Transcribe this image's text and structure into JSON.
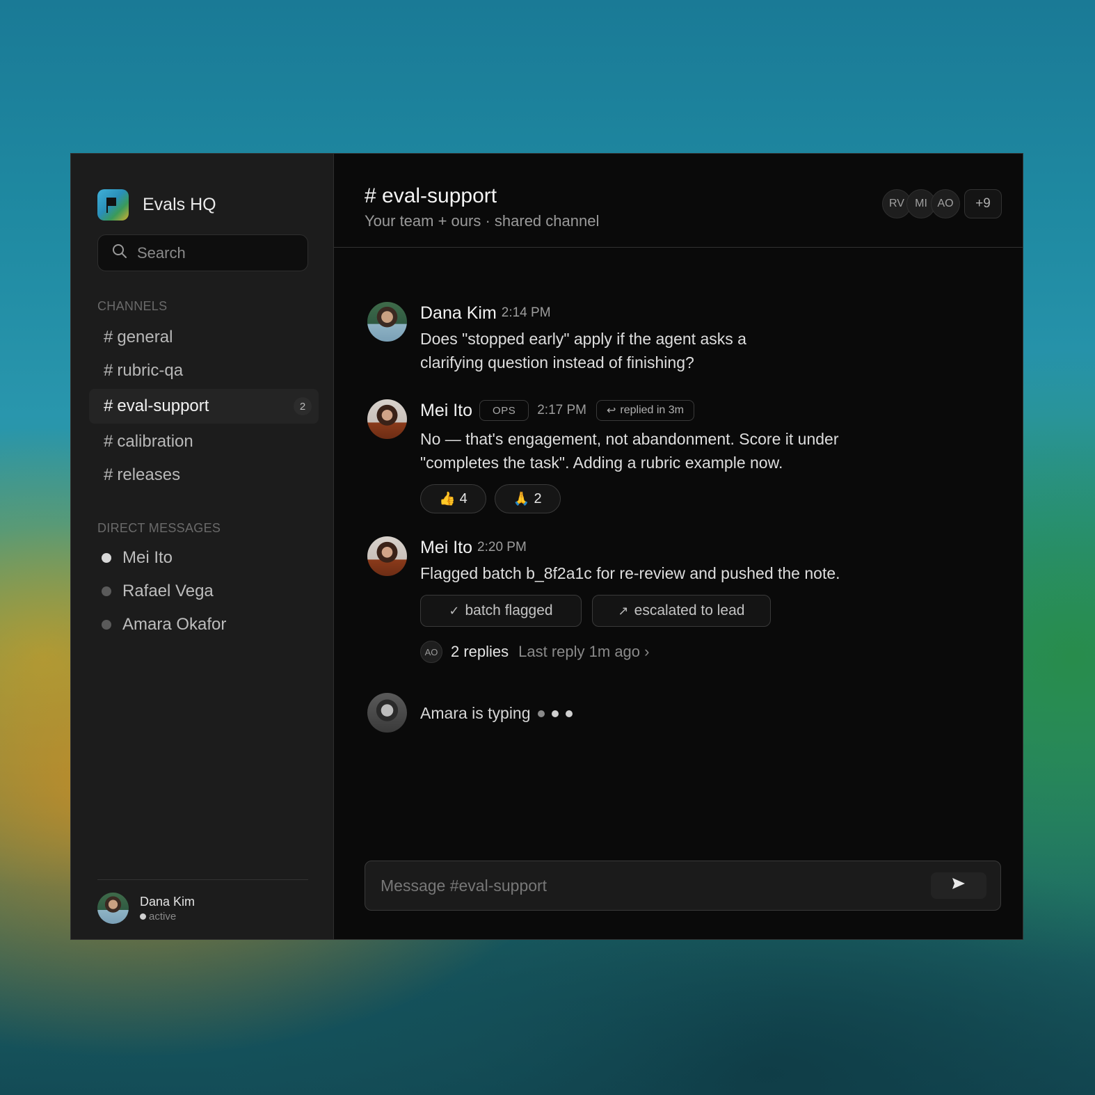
{
  "workspace": {
    "name": "Evals HQ"
  },
  "search": {
    "placeholder": "Search"
  },
  "channels": {
    "label": "CHANNELS",
    "items": [
      {
        "name": "general"
      },
      {
        "name": "rubric-qa"
      },
      {
        "name": "eval-support",
        "unread": "2"
      },
      {
        "name": "calibration"
      },
      {
        "name": "releases"
      }
    ]
  },
  "direct_messages": {
    "label": "DIRECT MESSAGES",
    "items": [
      {
        "name": "Mei Ito"
      },
      {
        "name": "Rafael Vega"
      },
      {
        "name": "Amara Okafor"
      }
    ]
  },
  "current_user": {
    "name": "Dana Kim",
    "status": "active"
  },
  "header": {
    "title": "# eval-support",
    "subtitle": "Your team + ours · shared channel",
    "members": [
      "RV",
      "MI",
      "AO"
    ],
    "more_members": "+9"
  },
  "messages": [
    {
      "author": "Dana Kim",
      "time": "2:14 PM",
      "text": "Does \"stopped early\" apply if the agent asks a clarifying question instead of finishing?"
    },
    {
      "author": "Mei Ito",
      "tag": "OPS",
      "time": "2:17 PM",
      "replied": "replied in 3m",
      "text": "No — that's engagement, not abandonment. Score it under \"completes the task\". Adding a rubric example now.",
      "reactions": [
        {
          "emoji": "👍",
          "count": "4"
        },
        {
          "emoji": "🙏",
          "count": "2"
        }
      ]
    },
    {
      "author": "Mei Ito",
      "time": "2:20 PM",
      "text": "Flagged batch b_8f2a1c for re-review and pushed the note.",
      "actions": [
        {
          "icon": "check-icon",
          "label": "batch flagged"
        },
        {
          "icon": "arrow-up-right-icon",
          "label": "escalated to lead"
        }
      ],
      "thread": {
        "avatar": "AO",
        "replies": "2 replies",
        "last_reply": "Last reply 1m ago ›"
      }
    }
  ],
  "typing": {
    "text": "Amara is typing"
  },
  "composer": {
    "placeholder": "Message #eval-support",
    "send_icon": "send-icon"
  }
}
